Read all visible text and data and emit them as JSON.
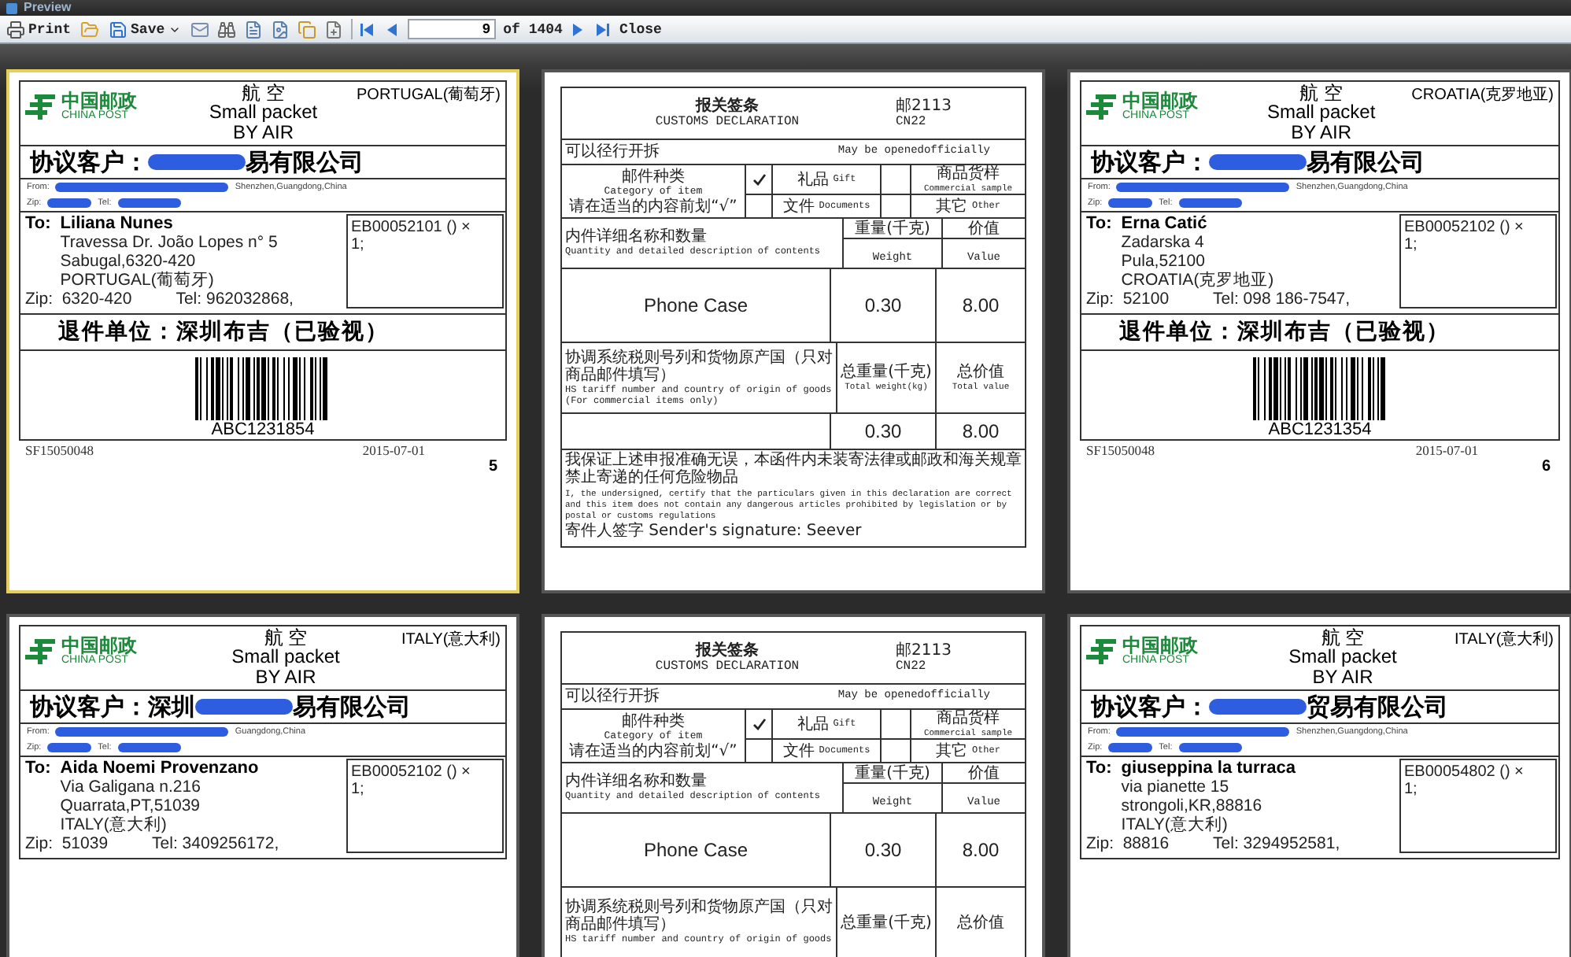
{
  "window": {
    "title": "Preview"
  },
  "toolbar": {
    "print": "Print",
    "save": "Save",
    "page": "9",
    "page_total": "of 1404",
    "close": "Close"
  },
  "pages": [
    {
      "kind": "label",
      "selected": true,
      "brand_cn": "中国邮政",
      "brand_en": "CHINA POST",
      "service_cn": "航 空",
      "service_en": "Small packet",
      "service_air": "BY AIR",
      "country": "PORTUGAL(葡萄牙)",
      "customer_label": "协议客户：",
      "customer_end": "易有限公司",
      "from_label": "From:",
      "from_city": "Shenzhen,Guangdong,China",
      "zip_label": "Zip:",
      "tel_label": "Tel:",
      "to_label": "To:",
      "recipient": "Liliana Nunes",
      "address": [
        "Travessa Dr. João Lopes n° 5",
        "Sabugal,6320-420",
        "PORTUGAL(葡萄牙)"
      ],
      "items": [
        "EB00052101 () ×",
        "1;"
      ],
      "zip": "Zip:  6320-420",
      "tel": "Tel: 962032868,",
      "return_unit": "退件单位：深圳布吉（已验视）",
      "barcode": "ABC1231854",
      "sender_code": "SF15050048",
      "date": "2015-07-01",
      "page_number": "5"
    },
    {
      "kind": "customs",
      "selected": false,
      "title_cn": "报关签条",
      "title_en": "CUSTOMS DECLARATION",
      "code_cn": "邮2113",
      "code_en": "CN22",
      "opened_cn": "可以径行开拆",
      "opened_en": "May be openedofficially",
      "category_cn": "邮件种类",
      "category_en": "Category of item",
      "category_hint": "请在适当的内容前划“√”",
      "options": [
        {
          "label_cn": "礼品",
          "label_en": "Gift",
          "checked": true
        },
        {
          "label_cn": "文件",
          "label_en": "Documents",
          "checked": false
        }
      ],
      "other_options": [
        {
          "cn": "商品货样",
          "en": "Commercial sample"
        },
        {
          "cn": "其它",
          "en": "Other"
        }
      ],
      "contents_cn": "内件详细名称和数量",
      "contents_en": "Quantity and detailed description of contents",
      "weight_cn": "重量(千克)",
      "weight_en": "Weight",
      "value_cn": "价值",
      "value_en": "Value",
      "item": "Phone Case",
      "weight": "0.30",
      "value": "8.00",
      "hs_cn": "协调系统税则号列和货物原产国（只对商品邮件填写）",
      "hs_en": "HS tariff number and country of origin of goods",
      "hs_note": "(For commercial items only)",
      "total_weight_cn": "总重量(千克)",
      "total_weight_en": "Total weight(kg)",
      "total_value_cn": "总价值",
      "total_value_en": "Total value",
      "total_weight": "0.30",
      "total_value": "8.00",
      "declaration_cn": "我保证上述申报准确无误，本函件内未装寄法律或邮政和海关规章禁止寄递的任何危险物品",
      "declaration_en": "I, the undersigned, certify that the particulars given in this declaration are correct and this item does not contain any dangerous articles prohibited by legislation or by postal or customs regulations",
      "signature": "寄件人签字 Sender's signature: Seever"
    },
    {
      "kind": "label",
      "selected": false,
      "brand_cn": "中国邮政",
      "brand_en": "CHINA POST",
      "service_cn": "航 空",
      "service_en": "Small packet",
      "service_air": "BY AIR",
      "country": "CROATIA(克罗地亚)",
      "customer_label": "协议客户：",
      "customer_end": "易有限公司",
      "from_label": "From:",
      "from_city": "Shenzhen,Guangdong,China",
      "zip_label": "Zip:",
      "tel_label": "Tel:",
      "to_label": "To:",
      "recipient": "Erna Catić",
      "address": [
        "Zadarska 4",
        "Pula,52100",
        "CROATIA(克罗地亚)"
      ],
      "items": [
        "EB00052102 () ×",
        "1;"
      ],
      "zip": "Zip:  52100",
      "tel": "Tel: 098 186-7547,",
      "return_unit": "退件单位：深圳布吉（已验视）",
      "barcode": "ABC1231354",
      "sender_code": "SF15050048",
      "date": "2015-07-01",
      "page_number": "6"
    },
    {
      "kind": "label",
      "selected": false,
      "brand_cn": "中国邮政",
      "brand_en": "CHINA POST",
      "service_cn": "航 空",
      "service_en": "Small packet",
      "service_air": "BY AIR",
      "country": "ITALY(意大利)",
      "customer_label": "协议客户：深圳",
      "customer_end": "易有限公司",
      "from_label": "From:",
      "from_city": "Guangdong,China",
      "zip_label": "Zip:",
      "tel_label": "Tel:",
      "to_label": "To:",
      "recipient": "Aida Noemi Provenzano",
      "address": [
        "Via Galigana n.216",
        "Quarrata,PT,51039",
        "ITALY(意大利)"
      ],
      "items": [
        "EB00052102 () ×",
        "1;"
      ],
      "zip": "Zip:  51039",
      "tel": "Tel: 3409256172,"
    },
    {
      "kind": "customs",
      "selected": false,
      "title_cn": "报关签条",
      "title_en": "CUSTOMS DECLARATION",
      "code_cn": "邮2113",
      "code_en": "CN22",
      "opened_cn": "可以径行开拆",
      "opened_en": "May be openedofficially",
      "category_cn": "邮件种类",
      "category_en": "Category of item",
      "category_hint": "请在适当的内容前划“√”",
      "options": [
        {
          "label_cn": "礼品",
          "label_en": "Gift",
          "checked": true
        },
        {
          "label_cn": "文件",
          "label_en": "Documents",
          "checked": false
        }
      ],
      "other_options": [
        {
          "cn": "商品货样",
          "en": "Commercial sample"
        },
        {
          "cn": "其它",
          "en": "Other"
        }
      ],
      "contents_cn": "内件详细名称和数量",
      "contents_en": "Quantity and detailed description of contents",
      "weight_cn": "重量(千克)",
      "weight_en": "Weight",
      "value_cn": "价值",
      "value_en": "Value",
      "item": "Phone Case",
      "weight": "0.30",
      "value": "8.00",
      "hs_cn": "协调系统税则号列和货物原产国（只对商品邮件填写）",
      "hs_en": "HS tariff number and country of origin of goods",
      "total_weight_cn": "总重量(千克)",
      "total_value_cn": "总价值"
    },
    {
      "kind": "label",
      "selected": false,
      "brand_cn": "中国邮政",
      "brand_en": "CHINA POST",
      "service_cn": "航 空",
      "service_en": "Small packet",
      "service_air": "BY AIR",
      "country": "ITALY(意大利)",
      "customer_label": "协议客户：",
      "customer_end": "贸易有限公司",
      "from_label": "From:",
      "from_city": "Shenzhen,Guangdong,China",
      "zip_label": "Zip:",
      "tel_label": "Tel:",
      "to_label": "To:",
      "recipient": "giuseppina la turraca",
      "address": [
        "via pianette 15",
        "strongoli,KR,88816",
        "ITALY(意大利)"
      ],
      "items": [
        "EB00054802 () ×",
        "1;"
      ],
      "zip": "Zip:  88816",
      "tel": "Tel: 3294952581,"
    }
  ]
}
